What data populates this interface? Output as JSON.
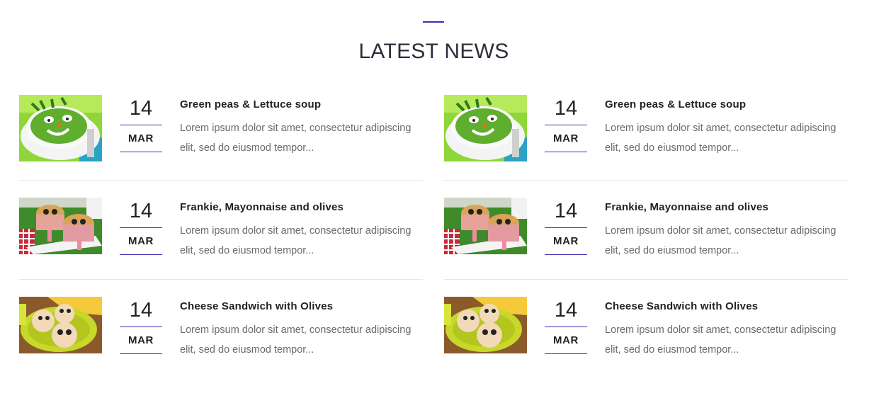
{
  "section": {
    "title": "LATEST NEWS"
  },
  "news": [
    {
      "day": "14",
      "month": "MAR",
      "title": "Green peas & Lettuce soup",
      "excerpt": "Lorem ipsum dolor sit amet, consectetur adipiscing elit, sed do eiusmod tempor...",
      "image": "green-soup-smiley-face-image"
    },
    {
      "day": "14",
      "month": "MAR",
      "title": "Frankie, Mayonnaise and olives",
      "excerpt": "Lorem ipsum dolor sit amet, consectetur adipiscing elit, sed do eiusmod tempor...",
      "image": "frankie-sandwich-faces-image"
    },
    {
      "day": "14",
      "month": "MAR",
      "title": "Cheese Sandwich with Olives",
      "excerpt": "Lorem ipsum dolor sit amet, consectetur adipiscing elit, sed do eiusmod tempor...",
      "image": "cheese-sandwich-olives-image"
    }
  ],
  "colors": {
    "accent": "#3b2fb3",
    "title": "#2b2f3a",
    "excerpt": "#6b6b6b",
    "divider": "#e6e6e6"
  }
}
